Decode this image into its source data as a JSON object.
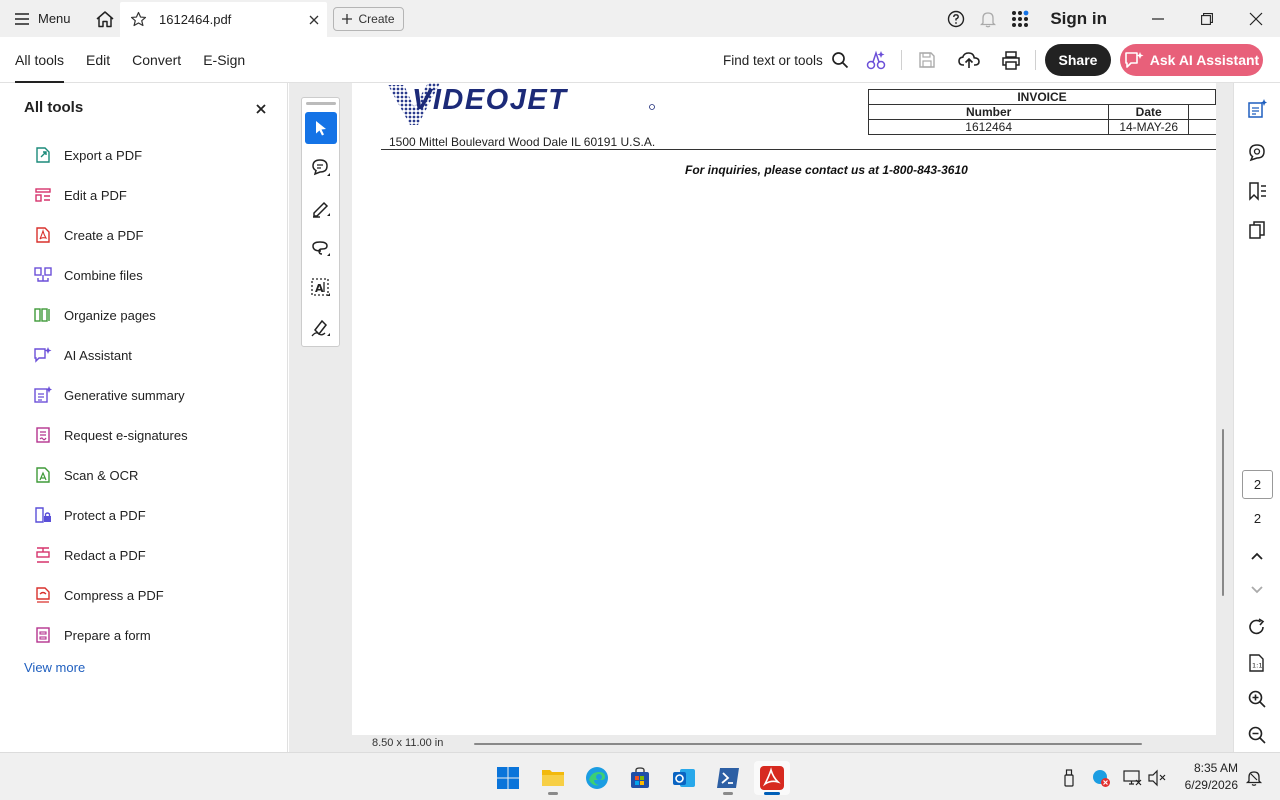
{
  "titlebar": {
    "menu_label": "Menu",
    "tab_title": "1612464.pdf",
    "create_label": "Create",
    "signin_label": "Sign in"
  },
  "toolbar": {
    "tabs": [
      {
        "label": "All tools",
        "active": true
      },
      {
        "label": "Edit",
        "active": false
      },
      {
        "label": "Convert",
        "active": false
      },
      {
        "label": "E-Sign",
        "active": false
      }
    ],
    "find_label": "Find text or tools",
    "share_label": "Share",
    "ai_label": "Ask AI Assistant"
  },
  "left_panel": {
    "title": "All tools",
    "items": [
      {
        "label": "Export a PDF",
        "icon": "export-pdf-icon",
        "color": "#1b8a7a"
      },
      {
        "label": "Edit a PDF",
        "icon": "edit-pdf-icon",
        "color": "#d6336c"
      },
      {
        "label": "Create a PDF",
        "icon": "create-pdf-icon",
        "color": "#d9302c"
      },
      {
        "label": "Combine files",
        "icon": "combine-files-icon",
        "color": "#6b4fd8"
      },
      {
        "label": "Organize pages",
        "icon": "organize-pages-icon",
        "color": "#3f9a38"
      },
      {
        "label": "AI Assistant",
        "icon": "ai-assistant-icon",
        "color": "#6b4fd8"
      },
      {
        "label": "Generative summary",
        "icon": "generative-summary-icon",
        "color": "#6b4fd8"
      },
      {
        "label": "Request e-signatures",
        "icon": "request-esignatures-icon",
        "color": "#b5338f"
      },
      {
        "label": "Scan & OCR",
        "icon": "scan-ocr-icon",
        "color": "#3f9a38"
      },
      {
        "label": "Protect a PDF",
        "icon": "protect-pdf-icon",
        "color": "#5a4fd8"
      },
      {
        "label": "Redact a PDF",
        "icon": "redact-pdf-icon",
        "color": "#d6336c"
      },
      {
        "label": "Compress a PDF",
        "icon": "compress-pdf-icon",
        "color": "#d9302c"
      },
      {
        "label": "Prepare a form",
        "icon": "prepare-form-icon",
        "color": "#b5338f"
      }
    ],
    "view_more": "View more"
  },
  "document": {
    "logo_text": "VIDEOJET",
    "address": "1500 Mittel Boulevard Wood Dale IL 60191 U.S.A.",
    "inquiry": "For inquiries, please contact us at 1-800-843-3610",
    "invoice": {
      "title": "INVOICE",
      "number_label": "Number",
      "date_label": "Date",
      "number": "1612464",
      "date": "14-MAY-26"
    },
    "page_size": "8.50 x 11.00 in"
  },
  "right_rail": {
    "current_page": "2",
    "total_pages": "2"
  },
  "taskbar": {
    "time": "8:35 AM",
    "date": "6/29/2026"
  },
  "colors": {
    "accent": "#1473e6",
    "ai_button": "#e8607a",
    "link": "#1f5fbf"
  }
}
